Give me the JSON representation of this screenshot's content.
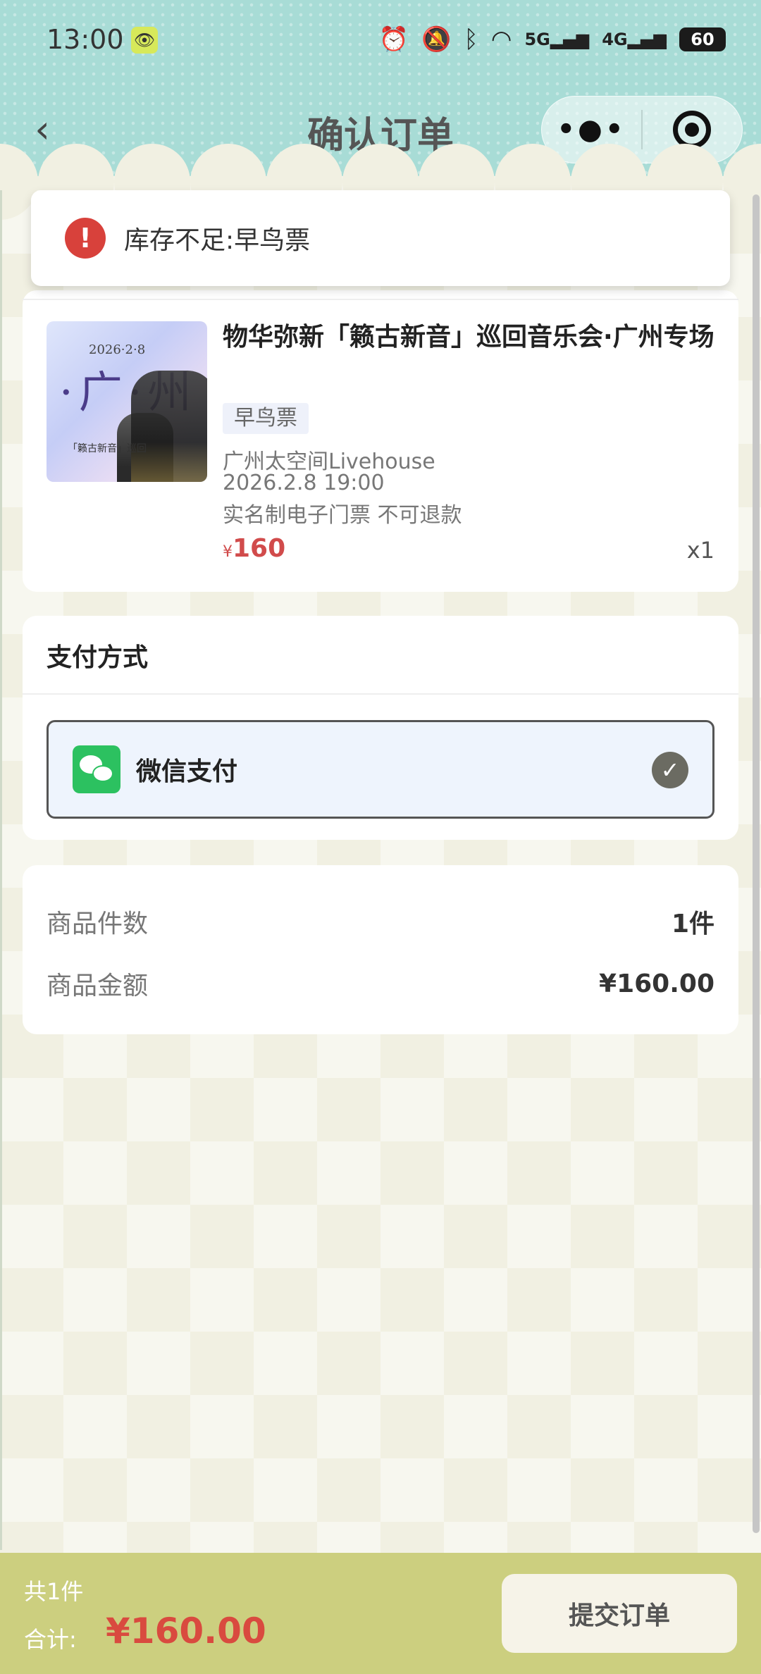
{
  "status_bar": {
    "time": "13:00",
    "battery": "60",
    "network_label": "5G 4G"
  },
  "nav": {
    "title": "确认订单",
    "back_icon": "chevron-left-icon",
    "more_icon": "more-dots-icon",
    "close_icon": "target-circle-icon"
  },
  "toast": {
    "message": "库存不足:早鸟票",
    "icon": "error-icon"
  },
  "product": {
    "title": "物华弥新「籁古新音」巡回音乐会·广州专场",
    "ticket_type": "早鸟票",
    "venue": "广州太空间Livehouse",
    "datetime": "2026.2.8 19:00",
    "note": "实名制电子门票 不可退款",
    "currency": "¥",
    "price": "160",
    "quantity": "x1",
    "poster_date": "2026·2·8",
    "poster_city": "·广·州",
    "poster_sub": "「籁古新音」巡回"
  },
  "payment": {
    "title": "支付方式",
    "method_label": "微信支付",
    "selected": true
  },
  "summary": {
    "count_label": "商品件数",
    "count_value": "1件",
    "amount_label": "商品金额",
    "amount_value": "¥160.00"
  },
  "bottom": {
    "count_text": "共1件",
    "total_label": "合计:",
    "total_value": "¥160.00",
    "submit_label": "提交订单"
  },
  "colors": {
    "header_teal": "#a8dcd6",
    "price_red": "#d14b4b",
    "bottom_bar": "#cccf7f",
    "wechat_green": "#2cc160",
    "error_red": "#d8413b"
  }
}
